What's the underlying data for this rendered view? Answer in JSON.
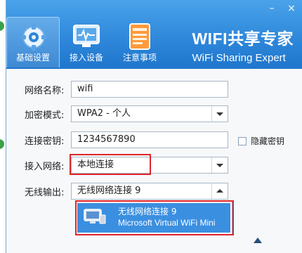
{
  "window": {
    "controls": {
      "minimize": "–",
      "close": "×"
    },
    "brand": {
      "title_cn": "WIFI共享专家",
      "title_en": "WiFi Sharing Expert"
    }
  },
  "nav": {
    "items": [
      {
        "label": "基础设置",
        "icon": "gear-icon",
        "active": true
      },
      {
        "label": "接入设备",
        "icon": "monitor-icon",
        "active": false
      },
      {
        "label": "注意事项",
        "icon": "notebook-icon",
        "active": false
      }
    ]
  },
  "form": {
    "ssid": {
      "label": "网络名称:",
      "value": "wifi"
    },
    "encryption": {
      "label": "加密模式:",
      "value": "WPA2 - 个人"
    },
    "password": {
      "label": "连接密钥:",
      "value": "1234567890"
    },
    "hide_password": {
      "label": "隐藏密钥",
      "checked": false
    },
    "access_network": {
      "label": "接入网络:",
      "value": "本地连接"
    },
    "wireless_output": {
      "label": "无线输出:",
      "value": "无线网络连接 9"
    }
  },
  "dropdown": {
    "options": [
      {
        "line1": "无线网络连接 9",
        "line2": "Microsoft Virtual WiFi Mini"
      }
    ]
  },
  "colors": {
    "header_blue": "#2d86d9",
    "highlight_red": "#e0252b",
    "selection_blue": "#3b8fe0"
  }
}
